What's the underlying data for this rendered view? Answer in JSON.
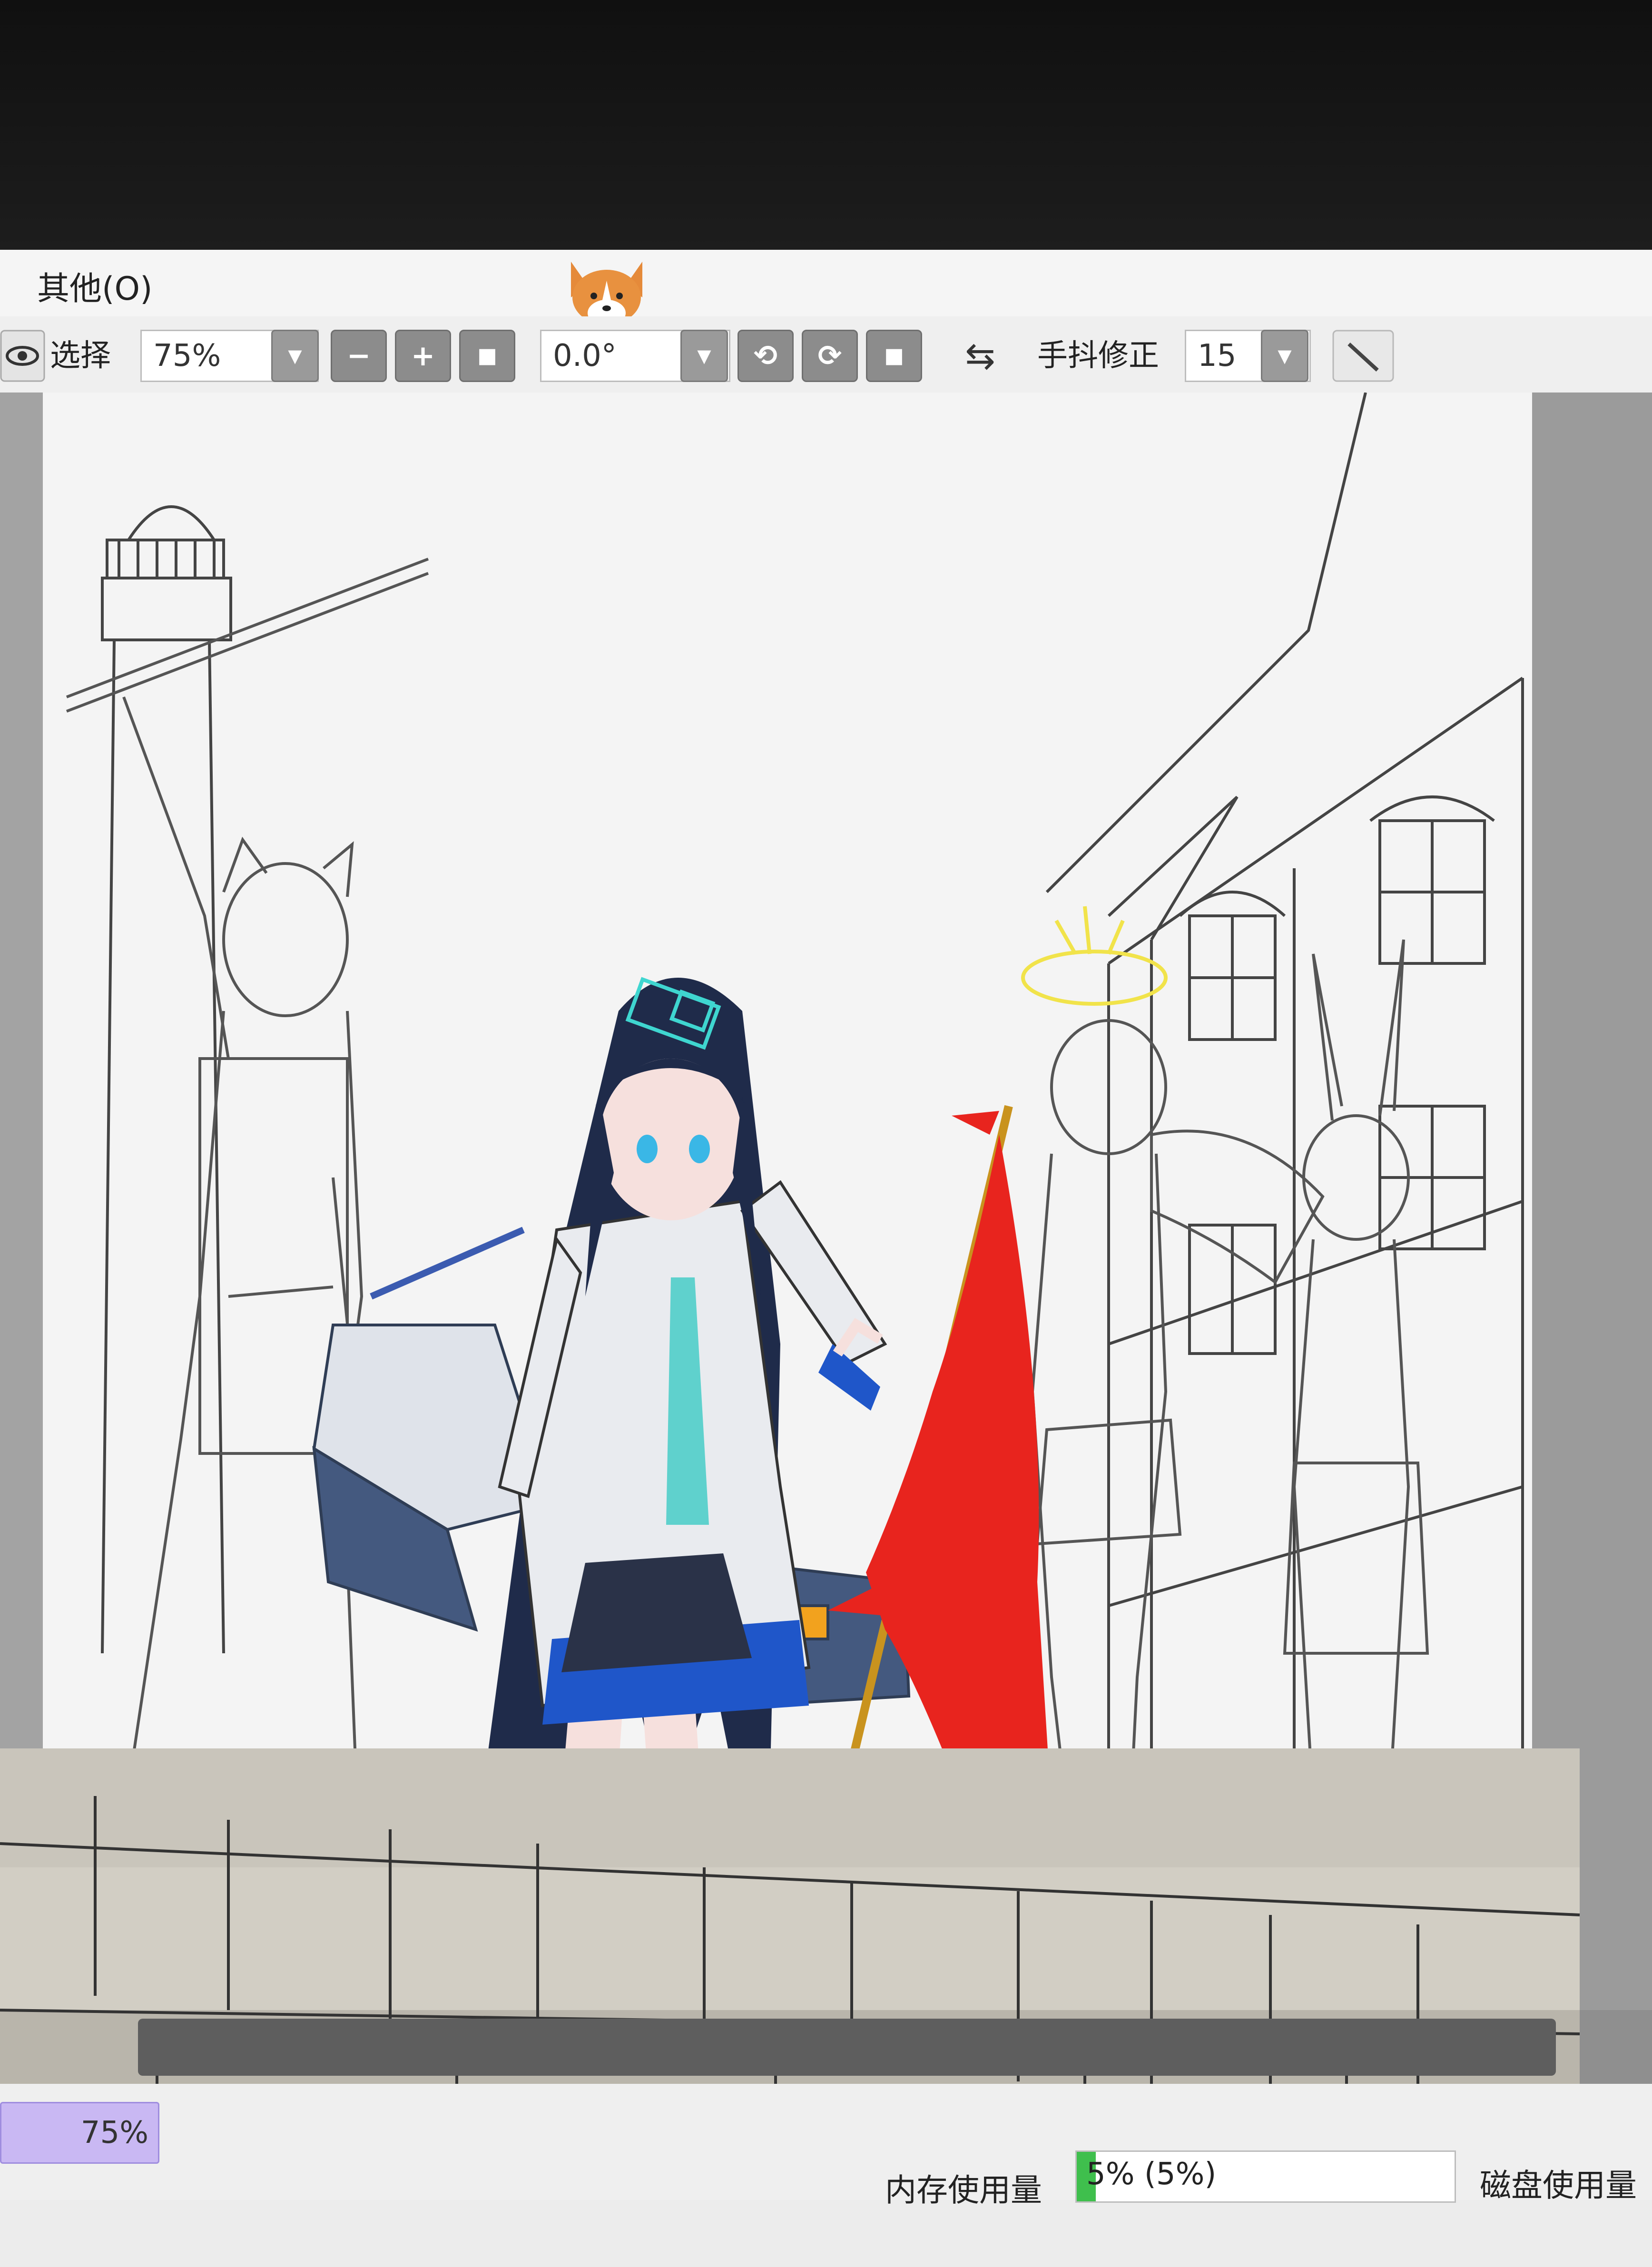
{
  "menu": {
    "other": "其他(O)"
  },
  "toolbar": {
    "select_label": "选择",
    "zoom_value": "75%",
    "zoom_out": "−",
    "zoom_in": "+",
    "zoom_reset": "■",
    "rotation_value": "0.0°",
    "rotate_ccw": "⟲",
    "rotate_cw": "⟳",
    "rotate_reset": "■",
    "flip_icon": "⇆",
    "stabilizer_label": "手抖修正",
    "stabilizer_value": "15"
  },
  "status": {
    "zoom": "75%",
    "memory_label": "内存使用量",
    "memory_value": "5% (5%)",
    "memory_fraction": 0.05,
    "disk_label": "磁盘使用量"
  },
  "colors": {
    "flag": "#e8241e",
    "halo_left": "#3fd6d0",
    "halo_right": "#f1e34a",
    "memory_bar": "#3fbf4d",
    "zoom_status_bg": "#c9b8f3"
  }
}
